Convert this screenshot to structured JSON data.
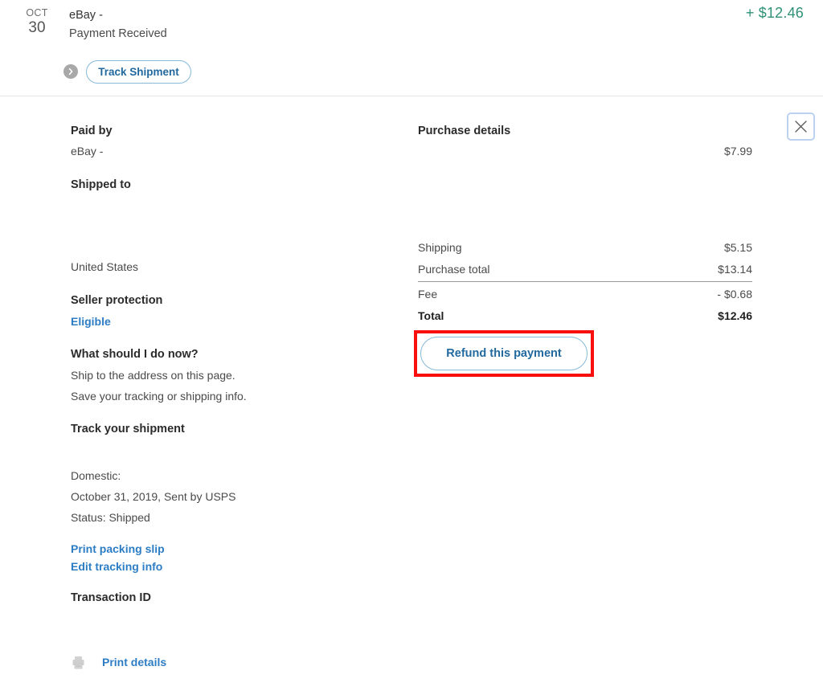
{
  "header": {
    "date_month": "OCT",
    "date_day": "30",
    "merchant": "eBay -",
    "status": "Payment Received",
    "amount": "+ $12.46",
    "amount_color": "#2e9177",
    "track_button": "Track Shipment",
    "chevron_icon": "chevron-right-icon"
  },
  "detail": {
    "close_icon": "close-icon",
    "left": {
      "paid_by_heading": "Paid by",
      "paid_by_value": "eBay -",
      "shipped_to_heading": "Shipped to",
      "shipped_to_country": "United States",
      "seller_protection_heading": "Seller protection",
      "seller_protection_status": "Eligible",
      "what_now_heading": "What should I do now?",
      "what_now_line1": "Ship to the address on this page.",
      "what_now_line2": "Save your tracking or shipping info.",
      "track_heading": "Track your shipment",
      "track_domestic_label": "Domestic:",
      "track_date": "October 31, 2019, Sent by USPS",
      "track_status": "Status: Shipped",
      "print_packing_slip": "Print packing slip",
      "edit_tracking_info": "Edit tracking info",
      "transaction_id_heading": "Transaction ID",
      "print_details": "Print details",
      "printer_icon": "printer-icon"
    },
    "right": {
      "purchase_details_heading": "Purchase details",
      "item_price": "$7.99",
      "rows": [
        {
          "label": "Shipping",
          "value": "$5.15"
        },
        {
          "label": "Purchase total",
          "value": "$13.14"
        },
        {
          "label": "Fee",
          "value": "- $0.68"
        },
        {
          "label": "Total",
          "value": "$12.46"
        }
      ],
      "refund_button": "Refund this payment",
      "annotation_color": "#fa0f0f"
    }
  }
}
